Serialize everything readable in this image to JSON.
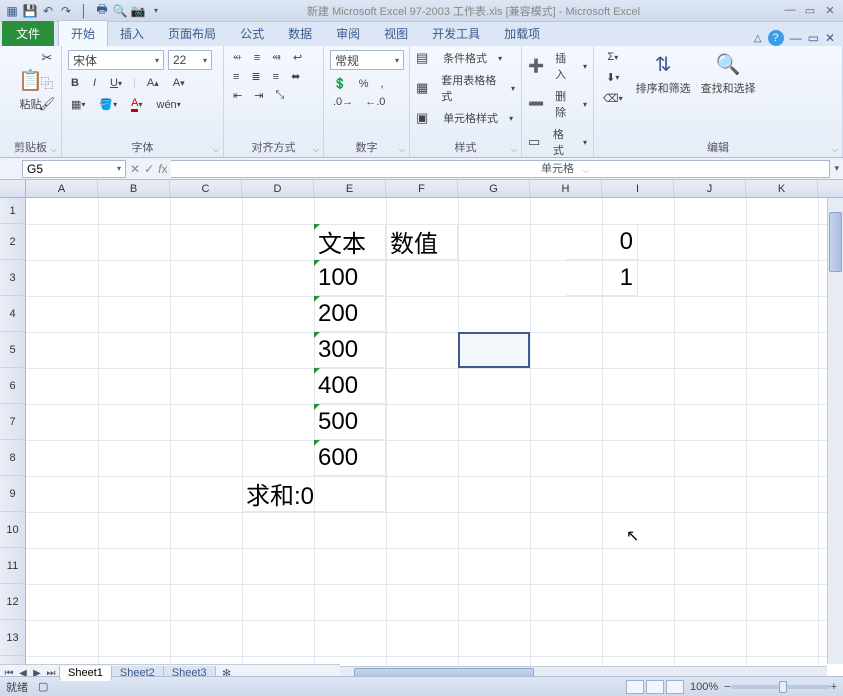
{
  "title": "新建 Microsoft Excel 97-2003 工作表.xls  [兼容模式] - Microsoft Excel",
  "tabs": {
    "file": "文件",
    "t0": "开始",
    "t1": "插入",
    "t2": "页面布局",
    "t3": "公式",
    "t4": "数据",
    "t5": "审阅",
    "t6": "视图",
    "t7": "开发工具",
    "t8": "加载项"
  },
  "ribbon": {
    "clipboard": {
      "paste": "粘贴",
      "label": "剪贴板"
    },
    "font": {
      "name": "宋体",
      "size": "22",
      "label": "字体"
    },
    "align": {
      "label": "对齐方式"
    },
    "number": {
      "format": "常规",
      "label": "数字"
    },
    "style": {
      "cond": "条件格式",
      "tablefmt": "套用表格格式",
      "cellfmt": "单元格样式",
      "label": "样式"
    },
    "cells": {
      "insert": "插入",
      "delete": "删除",
      "format": "格式",
      "label": "单元格"
    },
    "edit": {
      "sort": "排序和筛选",
      "find": "查找和选择",
      "label": "编辑"
    }
  },
  "namebox": "G5",
  "columns": [
    "A",
    "B",
    "C",
    "D",
    "E",
    "F",
    "G",
    "H",
    "I",
    "J",
    "K"
  ],
  "rows": [
    "1",
    "2",
    "3",
    "4",
    "5",
    "6",
    "7",
    "8",
    "9",
    "10",
    "11",
    "12",
    "13"
  ],
  "cells": {
    "d2": "文本",
    "e2": "数值",
    "h2": "0",
    "d3": "100",
    "h3": "1",
    "d4": "200",
    "d5": "300",
    "d6": "400",
    "d7": "500",
    "d8": "600",
    "c9": "求和:0"
  },
  "sheets": {
    "s1": "Sheet1",
    "s2": "Sheet2",
    "s3": "Sheet3"
  },
  "status": {
    "ready": "就绪",
    "zoom": "100%"
  }
}
